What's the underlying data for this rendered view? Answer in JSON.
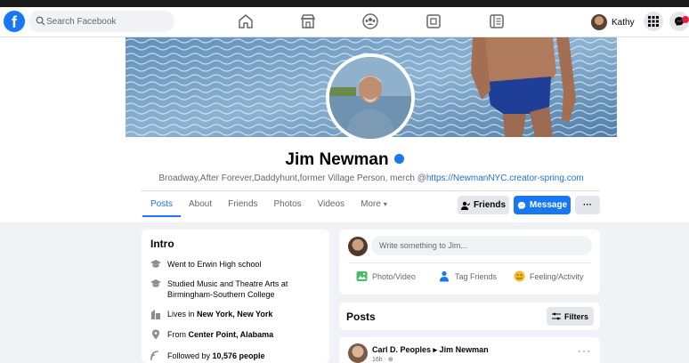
{
  "navbar": {
    "logo": "f",
    "search_placeholder": "Search Facebook",
    "nav_icons": [
      "home-icon",
      "pages-icon",
      "groups-icon",
      "gaming-icon",
      "news-icon"
    ],
    "user_name": "Kathy",
    "menu_icon": "grid-menu-icon",
    "messenger_icon": "messenger-icon"
  },
  "profile": {
    "name": "Jim Newman",
    "bio": "Broadway,After Forever,Daddyhunt,former Village Person, merch @",
    "bio_link": "https://NewmanNYC.creator-spring.com"
  },
  "tabs": [
    "Posts",
    "About",
    "Friends",
    "Photos",
    "Videos",
    "More"
  ],
  "tabs_active": "Posts",
  "actions": {
    "friends": "Friends",
    "message": "Message",
    "more": "···"
  },
  "intro": {
    "title": "Intro",
    "items": [
      {
        "icon": "school-icon",
        "text": "Went to Erwin High school"
      },
      {
        "icon": "school-icon",
        "text": "Studied Music and Theatre Arts at Birmingham-Southern College"
      },
      {
        "icon": "home-city-icon",
        "prefix": "Lives in ",
        "bold": "New York, New York"
      },
      {
        "icon": "location-pin-icon",
        "prefix": "From ",
        "bold": "Center Point, Alabama"
      },
      {
        "icon": "followers-icon",
        "prefix": "Followed by ",
        "bold": "10,576 people"
      }
    ]
  },
  "composer": {
    "placeholder": "Write something to Jim...",
    "actions": [
      "Photo/Video",
      "Tag Friends",
      "Feeling/Activity"
    ]
  },
  "posts": {
    "title": "Posts",
    "filters": "Filters"
  },
  "post": {
    "author": "Carl D. Peoples",
    "arrow": "▸",
    "recipient": "Jim Newman",
    "meta": "16h · ⊕",
    "more": "···"
  },
  "colors": {
    "brand": "#1877f2",
    "background": "#f0f2f5",
    "card": "#ffffff",
    "secondary_text": "#65676b",
    "notification": "#e41e3f"
  }
}
